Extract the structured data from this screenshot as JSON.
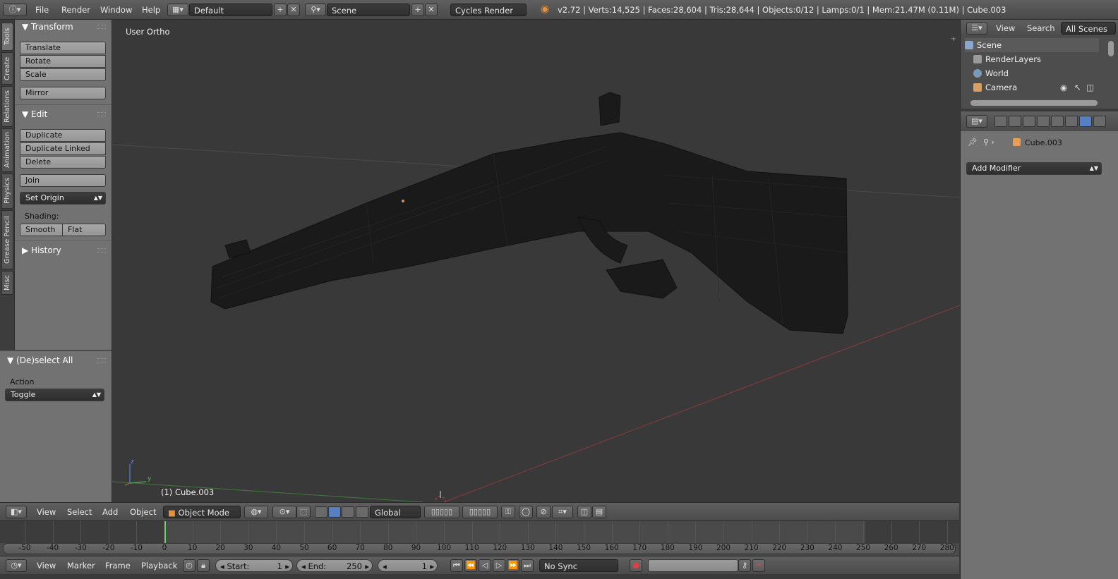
{
  "topbar": {
    "menus": [
      "File",
      "Render",
      "Window",
      "Help"
    ],
    "screen_layout": "Default",
    "scene": "Scene",
    "render_engine": "Cycles Render",
    "stats": "v2.72 | Verts:14,525 | Faces:28,604 | Tris:28,644 | Objects:0/12 | Lamps:0/1 | Mem:21.47M (0.11M) | Cube.003"
  },
  "vtabs": [
    "Tools",
    "Create",
    "Relations",
    "Animation",
    "Physics",
    "Grease Pencil",
    "Misc"
  ],
  "toolshelf": {
    "transform": {
      "title": "Transform",
      "buttons": [
        "Translate",
        "Rotate",
        "Scale",
        "Mirror"
      ]
    },
    "edit": {
      "title": "Edit",
      "buttons": [
        "Duplicate",
        "Duplicate Linked",
        "Delete",
        "Join"
      ],
      "set_origin": "Set Origin",
      "shading_label": "Shading:",
      "smooth": "Smooth",
      "flat": "Flat"
    },
    "history": {
      "title": "History"
    }
  },
  "operator": {
    "title": "(De)select All",
    "action_label": "Action",
    "action_value": "Toggle"
  },
  "viewport": {
    "view_label": "User Ortho",
    "object_label": "(1) Cube.003",
    "axis_z": "z",
    "axis_y": "y"
  },
  "view3d_header": {
    "menus": [
      "View",
      "Select",
      "Add",
      "Object"
    ],
    "mode": "Object Mode",
    "orientation": "Global"
  },
  "timeline": {
    "ticks": [
      "-50",
      "-40",
      "-30",
      "-20",
      "-10",
      "0",
      "10",
      "20",
      "30",
      "40",
      "50",
      "60",
      "70",
      "80",
      "90",
      "100",
      "110",
      "120",
      "130",
      "140",
      "150",
      "160",
      "170",
      "180",
      "190",
      "200",
      "210",
      "220",
      "230",
      "240",
      "250",
      "260",
      "270",
      "280"
    ],
    "current_frame": 0
  },
  "timeline_header": {
    "menus": [
      "View",
      "Marker",
      "Frame",
      "Playback"
    ],
    "start_label": "Start:",
    "start": "1",
    "end_label": "End:",
    "end": "250",
    "frame": "1",
    "sync": "No Sync"
  },
  "outliner": {
    "menus": [
      "View",
      "Search",
      "All Scenes"
    ],
    "rows": [
      "Scene",
      "RenderLayers",
      "World",
      "Camera"
    ]
  },
  "properties": {
    "object": "Cube.003",
    "add_modifier": "Add Modifier"
  }
}
